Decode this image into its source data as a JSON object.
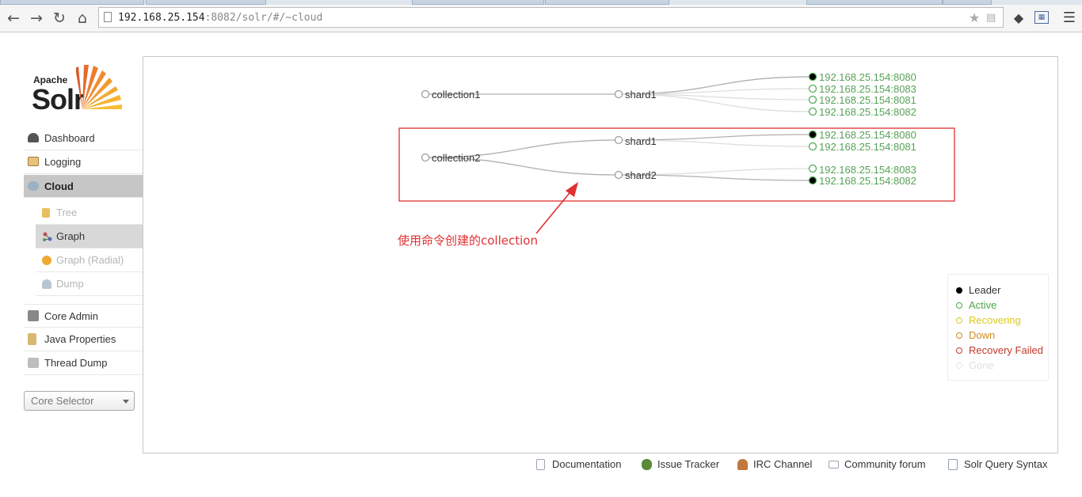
{
  "browser": {
    "url_host": "192.168.25.154",
    "url_rest": ":8082/solr/#/~cloud",
    "icons": [
      "back-icon",
      "forward-icon",
      "reload-icon",
      "home-icon",
      "star-icon",
      "translate-icon",
      "evernote-icon",
      "calendar-icon",
      "menu-icon"
    ]
  },
  "logo": {
    "apache": "Apache",
    "solr": "Solr"
  },
  "sidebar": {
    "items": [
      {
        "label": "Dashboard",
        "icon": "dashboard-icon",
        "color": "#555555"
      },
      {
        "label": "Logging",
        "icon": "logging-icon",
        "color": "#d8a24a"
      },
      {
        "label": "Cloud",
        "icon": "cloud-icon",
        "color": "#8aa4b8"
      },
      {
        "label": "Core Admin",
        "icon": "core-admin-icon",
        "color": "#7a7a7a"
      },
      {
        "label": "Java Properties",
        "icon": "java-properties-icon",
        "color": "#c9a45c"
      },
      {
        "label": "Thread Dump",
        "icon": "thread-dump-icon",
        "color": "#9a9a9a"
      }
    ],
    "cloud_sub": [
      {
        "label": "Tree",
        "icon": "tree-icon",
        "color": "#e0b050"
      },
      {
        "label": "Graph",
        "icon": "graph-icon",
        "color": "#c05050"
      },
      {
        "label": "Graph (Radial)",
        "icon": "graph-radial-icon",
        "color": "#e8a030"
      },
      {
        "label": "Dump",
        "icon": "dump-icon",
        "color": "#9aa8b8"
      }
    ],
    "core_selector": "Core Selector"
  },
  "graph": {
    "collections": [
      {
        "name": "collection1",
        "shards": [
          {
            "name": "shard1",
            "replicas": [
              {
                "host": "192.168.25.154:8080",
                "state": "leader"
              },
              {
                "host": "192.168.25.154:8083",
                "state": "active"
              },
              {
                "host": "192.168.25.154:8081",
                "state": "active"
              },
              {
                "host": "192.168.25.154:8082",
                "state": "active"
              }
            ]
          }
        ]
      },
      {
        "name": "collection2",
        "shards": [
          {
            "name": "shard1",
            "replicas": [
              {
                "host": "192.168.25.154:8080",
                "state": "leader"
              },
              {
                "host": "192.168.25.154:8081",
                "state": "active"
              }
            ]
          },
          {
            "name": "shard2",
            "replicas": [
              {
                "host": "192.168.25.154:8083",
                "state": "active"
              },
              {
                "host": "192.168.25.154:8082",
                "state": "leader"
              }
            ]
          }
        ]
      }
    ],
    "annotation": "使用命令创建的collection",
    "annotation_color": "#e03030"
  },
  "legend": [
    {
      "label": "Leader",
      "color": "#000000",
      "filled": true
    },
    {
      "label": "Active",
      "color": "#4aa84a",
      "filled": false
    },
    {
      "label": "Recovering",
      "color": "#d8c81e",
      "filled": false
    },
    {
      "label": "Down",
      "color": "#d08a1e",
      "filled": false
    },
    {
      "label": "Recovery Failed",
      "color": "#c0392b",
      "filled": false
    },
    {
      "label": "Gone",
      "color": "#e4e4e4",
      "filled": false
    }
  ],
  "footer": [
    {
      "label": "Documentation",
      "icon": "documentation-icon",
      "color": "#b8c4d0"
    },
    {
      "label": "Issue Tracker",
      "icon": "issue-tracker-icon",
      "color": "#5a8a3a"
    },
    {
      "label": "IRC Channel",
      "icon": "irc-channel-icon",
      "color": "#c07a40"
    },
    {
      "label": "Community forum",
      "icon": "community-forum-icon",
      "color": "#a8b4c0"
    },
    {
      "label": "Solr Query Syntax",
      "icon": "solr-query-syntax-icon",
      "color": "#90a0b0"
    }
  ]
}
